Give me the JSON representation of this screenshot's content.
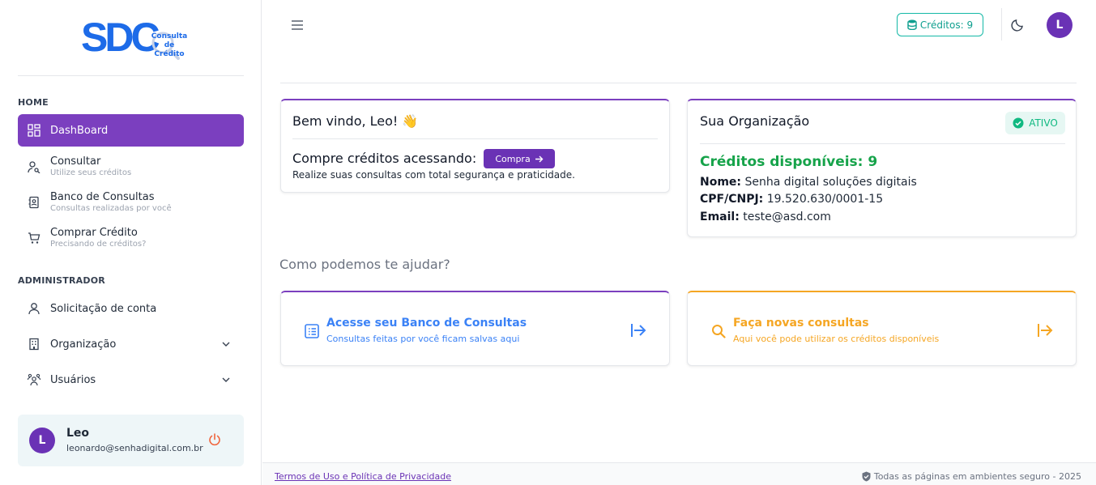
{
  "sidebar": {
    "logo": {
      "text": "SDC",
      "tagline_line1": "Consulta",
      "tagline_line2": "de Crédito"
    },
    "sections": {
      "home": "HOME",
      "admin": "ADMINISTRADOR"
    },
    "items": [
      {
        "label": "DashBoard",
        "sub": "",
        "icon": "dashboard-icon"
      },
      {
        "label": "Consultar",
        "sub": "Utilize seus créditos",
        "icon": "user-search-icon"
      },
      {
        "label": "Banco de Consultas",
        "sub": "Consultas realizadas por você",
        "icon": "contacts-book-icon"
      },
      {
        "label": "Comprar Crédito",
        "sub": "Precisando de créditos?",
        "icon": "cart-icon"
      },
      {
        "label": "Solicitação de conta",
        "sub": "",
        "icon": "user-icon"
      },
      {
        "label": "Organização",
        "sub": "",
        "icon": "building-icon"
      },
      {
        "label": "Usuários",
        "sub": "",
        "icon": "users-icon"
      }
    ],
    "user": {
      "initial": "L",
      "name": "Leo",
      "email": "leonardo@senhadigital.com.br"
    }
  },
  "header": {
    "credits_label": "Créditos: 9",
    "avatar_initial": "L"
  },
  "welcome": {
    "title": "Bem vindo, Leo! 👋",
    "buy_text": "Compre créditos acessando:",
    "buy_button": "Compra",
    "description": "Realize suas consultas com total segurança e praticidade."
  },
  "organization": {
    "title": "Sua Organização",
    "status": "ATIVO",
    "credits": "Créditos disponíveis: 9",
    "name_label": "Nome:",
    "name_value": "Senha digital soluções digitais",
    "doc_label": "CPF/CNPJ:",
    "doc_value": "19.520.630/0001-15",
    "email_label": "Email:",
    "email_value": "teste@asd.com"
  },
  "help": {
    "title": "Como podemos te ajudar?",
    "cards": [
      {
        "title": "Acesse seu Banco de Consultas",
        "sub": "Consultas feitas por você ficam salvas aqui"
      },
      {
        "title": "Faça novas consultas",
        "sub": "Aqui você pode utilizar os créditos disponíveis"
      }
    ]
  },
  "footer": {
    "terms": "Termos de Uso e Política de Privacidade",
    "secure": "Todas as páginas em ambientes seguro - 2025"
  },
  "colors": {
    "primary": "#7b3fbf",
    "teal": "#14b8a6",
    "green": "#16a34a",
    "blue": "#3b82f6",
    "orange": "#f5a623"
  }
}
